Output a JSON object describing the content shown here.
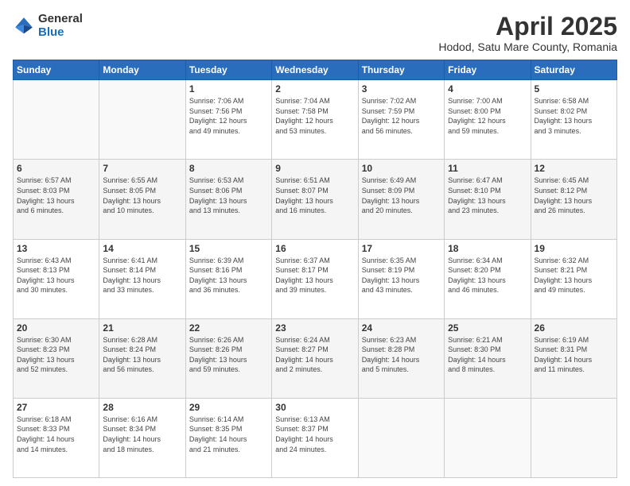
{
  "logo": {
    "general": "General",
    "blue": "Blue"
  },
  "header": {
    "title": "April 2025",
    "subtitle": "Hodod, Satu Mare County, Romania"
  },
  "weekdays": [
    "Sunday",
    "Monday",
    "Tuesday",
    "Wednesday",
    "Thursday",
    "Friday",
    "Saturday"
  ],
  "weeks": [
    [
      {
        "num": "",
        "info": ""
      },
      {
        "num": "",
        "info": ""
      },
      {
        "num": "1",
        "info": "Sunrise: 7:06 AM\nSunset: 7:56 PM\nDaylight: 12 hours\nand 49 minutes."
      },
      {
        "num": "2",
        "info": "Sunrise: 7:04 AM\nSunset: 7:58 PM\nDaylight: 12 hours\nand 53 minutes."
      },
      {
        "num": "3",
        "info": "Sunrise: 7:02 AM\nSunset: 7:59 PM\nDaylight: 12 hours\nand 56 minutes."
      },
      {
        "num": "4",
        "info": "Sunrise: 7:00 AM\nSunset: 8:00 PM\nDaylight: 12 hours\nand 59 minutes."
      },
      {
        "num": "5",
        "info": "Sunrise: 6:58 AM\nSunset: 8:02 PM\nDaylight: 13 hours\nand 3 minutes."
      }
    ],
    [
      {
        "num": "6",
        "info": "Sunrise: 6:57 AM\nSunset: 8:03 PM\nDaylight: 13 hours\nand 6 minutes."
      },
      {
        "num": "7",
        "info": "Sunrise: 6:55 AM\nSunset: 8:05 PM\nDaylight: 13 hours\nand 10 minutes."
      },
      {
        "num": "8",
        "info": "Sunrise: 6:53 AM\nSunset: 8:06 PM\nDaylight: 13 hours\nand 13 minutes."
      },
      {
        "num": "9",
        "info": "Sunrise: 6:51 AM\nSunset: 8:07 PM\nDaylight: 13 hours\nand 16 minutes."
      },
      {
        "num": "10",
        "info": "Sunrise: 6:49 AM\nSunset: 8:09 PM\nDaylight: 13 hours\nand 20 minutes."
      },
      {
        "num": "11",
        "info": "Sunrise: 6:47 AM\nSunset: 8:10 PM\nDaylight: 13 hours\nand 23 minutes."
      },
      {
        "num": "12",
        "info": "Sunrise: 6:45 AM\nSunset: 8:12 PM\nDaylight: 13 hours\nand 26 minutes."
      }
    ],
    [
      {
        "num": "13",
        "info": "Sunrise: 6:43 AM\nSunset: 8:13 PM\nDaylight: 13 hours\nand 30 minutes."
      },
      {
        "num": "14",
        "info": "Sunrise: 6:41 AM\nSunset: 8:14 PM\nDaylight: 13 hours\nand 33 minutes."
      },
      {
        "num": "15",
        "info": "Sunrise: 6:39 AM\nSunset: 8:16 PM\nDaylight: 13 hours\nand 36 minutes."
      },
      {
        "num": "16",
        "info": "Sunrise: 6:37 AM\nSunset: 8:17 PM\nDaylight: 13 hours\nand 39 minutes."
      },
      {
        "num": "17",
        "info": "Sunrise: 6:35 AM\nSunset: 8:19 PM\nDaylight: 13 hours\nand 43 minutes."
      },
      {
        "num": "18",
        "info": "Sunrise: 6:34 AM\nSunset: 8:20 PM\nDaylight: 13 hours\nand 46 minutes."
      },
      {
        "num": "19",
        "info": "Sunrise: 6:32 AM\nSunset: 8:21 PM\nDaylight: 13 hours\nand 49 minutes."
      }
    ],
    [
      {
        "num": "20",
        "info": "Sunrise: 6:30 AM\nSunset: 8:23 PM\nDaylight: 13 hours\nand 52 minutes."
      },
      {
        "num": "21",
        "info": "Sunrise: 6:28 AM\nSunset: 8:24 PM\nDaylight: 13 hours\nand 56 minutes."
      },
      {
        "num": "22",
        "info": "Sunrise: 6:26 AM\nSunset: 8:26 PM\nDaylight: 13 hours\nand 59 minutes."
      },
      {
        "num": "23",
        "info": "Sunrise: 6:24 AM\nSunset: 8:27 PM\nDaylight: 14 hours\nand 2 minutes."
      },
      {
        "num": "24",
        "info": "Sunrise: 6:23 AM\nSunset: 8:28 PM\nDaylight: 14 hours\nand 5 minutes."
      },
      {
        "num": "25",
        "info": "Sunrise: 6:21 AM\nSunset: 8:30 PM\nDaylight: 14 hours\nand 8 minutes."
      },
      {
        "num": "26",
        "info": "Sunrise: 6:19 AM\nSunset: 8:31 PM\nDaylight: 14 hours\nand 11 minutes."
      }
    ],
    [
      {
        "num": "27",
        "info": "Sunrise: 6:18 AM\nSunset: 8:33 PM\nDaylight: 14 hours\nand 14 minutes."
      },
      {
        "num": "28",
        "info": "Sunrise: 6:16 AM\nSunset: 8:34 PM\nDaylight: 14 hours\nand 18 minutes."
      },
      {
        "num": "29",
        "info": "Sunrise: 6:14 AM\nSunset: 8:35 PM\nDaylight: 14 hours\nand 21 minutes."
      },
      {
        "num": "30",
        "info": "Sunrise: 6:13 AM\nSunset: 8:37 PM\nDaylight: 14 hours\nand 24 minutes."
      },
      {
        "num": "",
        "info": ""
      },
      {
        "num": "",
        "info": ""
      },
      {
        "num": "",
        "info": ""
      }
    ]
  ]
}
